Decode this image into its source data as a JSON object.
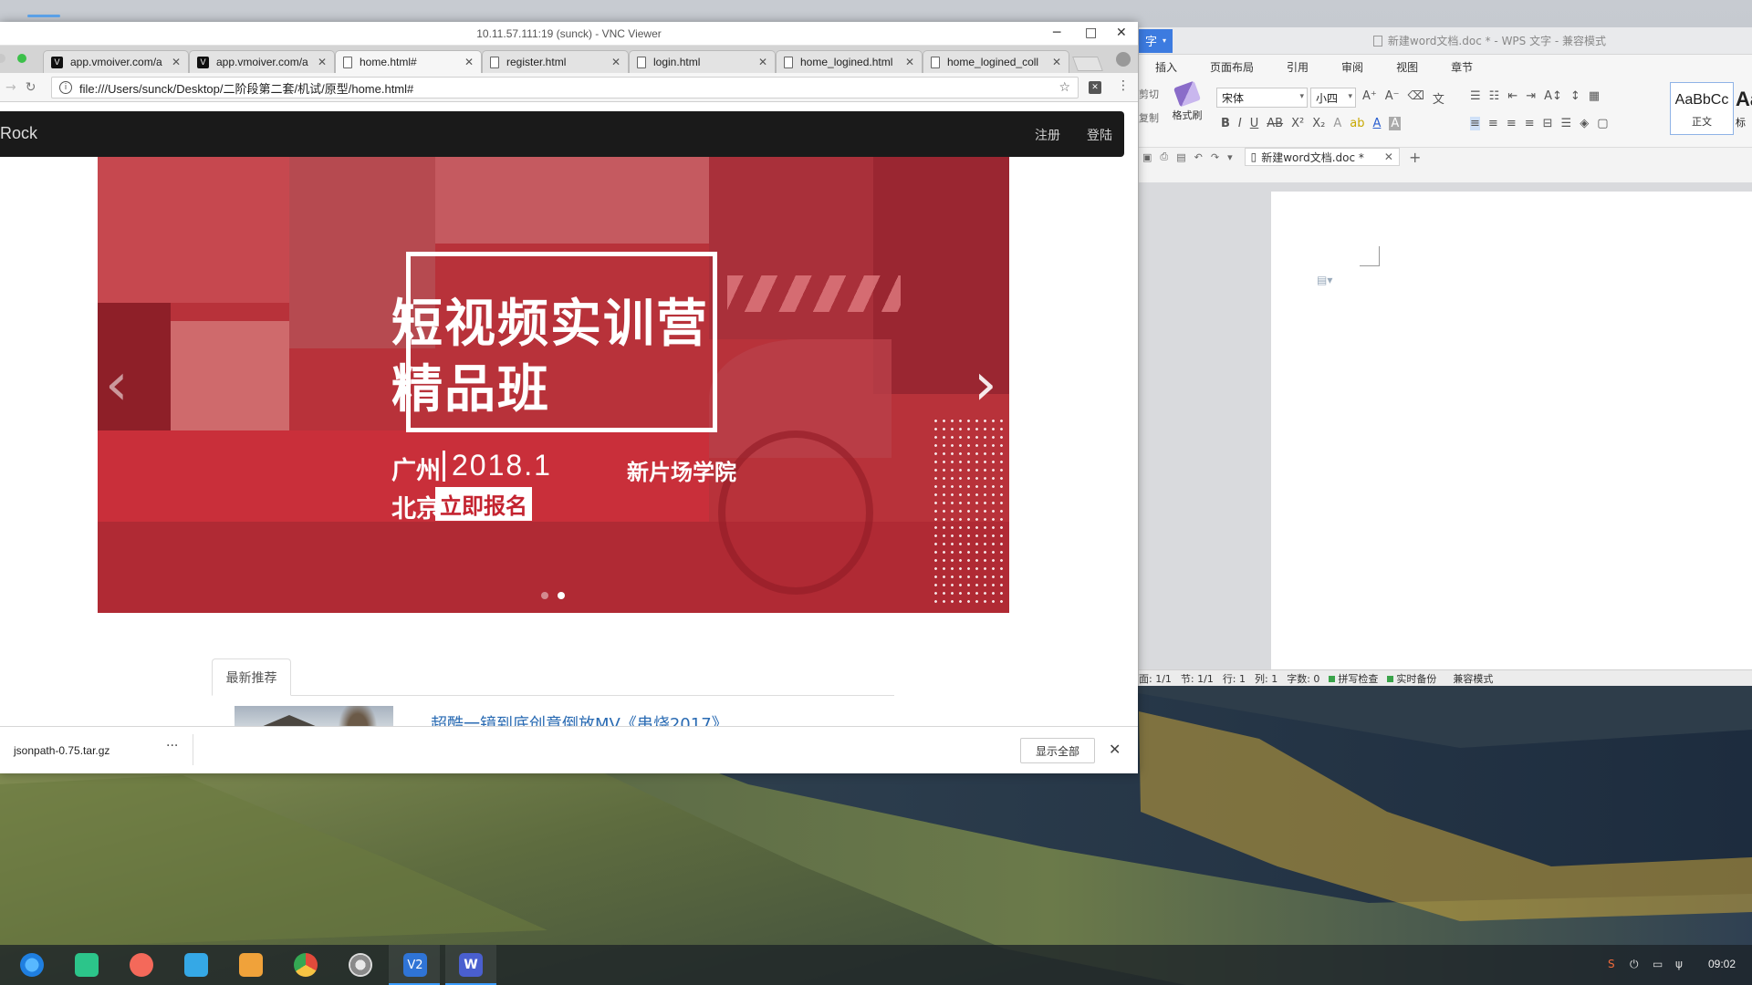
{
  "vnc": {
    "title": "10.11.57.111:19 (sunck) - VNC Viewer"
  },
  "browser": {
    "tabs": [
      {
        "label": "app.vmoiver.com/a",
        "icon": "vmovier-icon",
        "active": false
      },
      {
        "label": "app.vmoiver.com/a",
        "icon": "vmovier-icon",
        "active": false
      },
      {
        "label": "home.html#",
        "icon": "file-icon",
        "active": true
      },
      {
        "label": "register.html",
        "icon": "file-icon",
        "active": false
      },
      {
        "label": "login.html",
        "icon": "file-icon",
        "active": false
      },
      {
        "label": "home_logined.html",
        "icon": "file-icon",
        "active": false
      },
      {
        "label": "home_logined_coll",
        "icon": "file-icon",
        "active": false
      }
    ],
    "url": "file:///Users/sunck/Desktop/二阶段第二套/机试/原型/home.html#"
  },
  "site": {
    "brand": "Rock",
    "nav_register": "注册",
    "nav_login": "登陆",
    "banner": {
      "headline1": "短视频实训营",
      "headline2": "精品班",
      "city1": "广州",
      "date": "2018.1",
      "city2": "北京",
      "cta": "立即报名",
      "school": "新片场学院"
    },
    "carousel_prev": "‹",
    "carousel_next": "›",
    "carousel_active_index": 2,
    "carousel_count": 2,
    "section_tab": "最新推荐",
    "article_title": "超酷一镜到底创意倒放MV《串烧2017》"
  },
  "download_bar": {
    "filename": "jsonpath-0.75.tar.gz",
    "more": "···",
    "show_all": "显示全部",
    "close": "✕"
  },
  "wps": {
    "app_label": "字",
    "window_title": "新建word文档.doc * - WPS 文字 - 兼容模式",
    "menu": [
      "插入",
      "页面布局",
      "引用",
      "审阅",
      "视图",
      "章节"
    ],
    "cut": "剪切",
    "copy": "复制",
    "format_painter": "格式刷",
    "font_name": "宋体",
    "font_size": "小四",
    "style_preview": "AaBbCc",
    "style_name": "正文",
    "style2_preview": "Aa",
    "style2_name": "标",
    "doc_tab": "新建word文档.doc *",
    "status": {
      "page": "面: 1/1",
      "section": "节: 1/1",
      "row": "行: 1",
      "col": "列: 1",
      "words": "字数: 0",
      "spell": "拼写检查",
      "backup": "实时备份",
      "compat": "兼容模式"
    }
  },
  "taskbar": {
    "clock": "09:02",
    "apps": [
      "launcher-icon",
      "file-manager-icon",
      "screen-recorder-icon",
      "app-store-icon",
      "archive-icon",
      "chrome-icon",
      "settings-icon",
      "vnc-viewer-icon",
      "wps-writer-icon"
    ]
  },
  "colors": {
    "banner_red": "#b8323a",
    "link_blue": "#2a6bb3",
    "nav_dark": "#1a1a1a",
    "wps_blue": "#3c7be0"
  }
}
